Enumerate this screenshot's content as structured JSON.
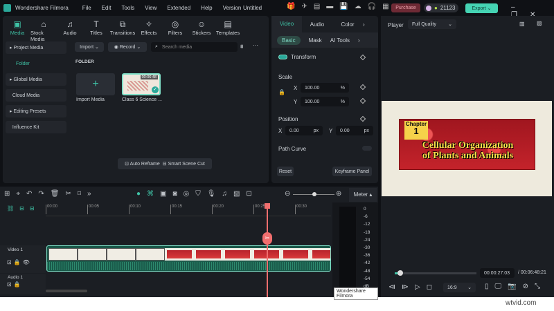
{
  "app": {
    "name": "Wondershare Filmora",
    "project": "Untitled",
    "menu": [
      "File",
      "Edit",
      "Tools",
      "View",
      "Extended",
      "Help",
      "Version"
    ],
    "purchase": "Purchase",
    "credits": "21123",
    "export": "Export"
  },
  "media_tabs": [
    {
      "label": "Media",
      "icon": "media-icon"
    },
    {
      "label": "Stock Media",
      "icon": "stock-icon"
    },
    {
      "label": "Audio",
      "icon": "music-icon"
    },
    {
      "label": "Titles",
      "icon": "titles-icon"
    },
    {
      "label": "Transitions",
      "icon": "transitions-icon"
    },
    {
      "label": "Effects",
      "icon": "effects-icon"
    },
    {
      "label": "Filters",
      "icon": "filters-icon"
    },
    {
      "label": "Stickers",
      "icon": "stickers-icon"
    },
    {
      "label": "Templates",
      "icon": "templates-icon"
    }
  ],
  "sidebar": {
    "project_media": "Project Media",
    "folder": "Folder",
    "items": [
      "Global Media",
      "Cloud Media",
      "Editing Presets",
      "Influence Kit"
    ]
  },
  "media": {
    "import": "Import",
    "record": "Record",
    "search_placeholder": "Search media",
    "folder_label": "FOLDER",
    "import_media": "Import Media",
    "clip_name": "Class 6 Science ...",
    "clip_duration": "00:06:48",
    "auto_reframe": "Auto Reframe",
    "smart_scene_cut": "Smart Scene Cut"
  },
  "properties": {
    "tabs": [
      "Video",
      "Audio",
      "Color"
    ],
    "subtabs": [
      "Basic",
      "Mask",
      "AI Tools"
    ],
    "transform": "Transform",
    "scale": "Scale",
    "scale_x": "100.00",
    "scale_y": "100.00",
    "pct": "%",
    "position": "Position",
    "pos_x": "0.00",
    "pos_y": "0.00",
    "px": "px",
    "x": "X",
    "y": "Y",
    "path_curve": "Path Curve",
    "reset": "Reset",
    "keyframe_panel": "Keyframe Panel"
  },
  "player": {
    "label": "Player",
    "quality": "Full Quality",
    "current": "00:00:27:03",
    "total": "/ 00:06:48:21",
    "ratio": "16:9",
    "progress": 0.07,
    "video_chapter": "Chapter",
    "video_chapter_num": "1",
    "video_title1": "Cellular Organization",
    "video_title2": "of Plants and Animals"
  },
  "timeline": {
    "ruler": [
      "00:00",
      "00:05",
      "00:10",
      "00:15",
      "00:20",
      "00:25",
      "00:30"
    ],
    "meter": "Meter",
    "meter_scale": [
      "0",
      "-6",
      "-12",
      "-18",
      "-24",
      "-30",
      "-36",
      "-42",
      "-48",
      "-54",
      "dB"
    ],
    "video_track": "Video 1",
    "audio_track": "Audio 1",
    "tooltip": "Wondershare Filmora"
  },
  "watermark": "wtvid.com"
}
